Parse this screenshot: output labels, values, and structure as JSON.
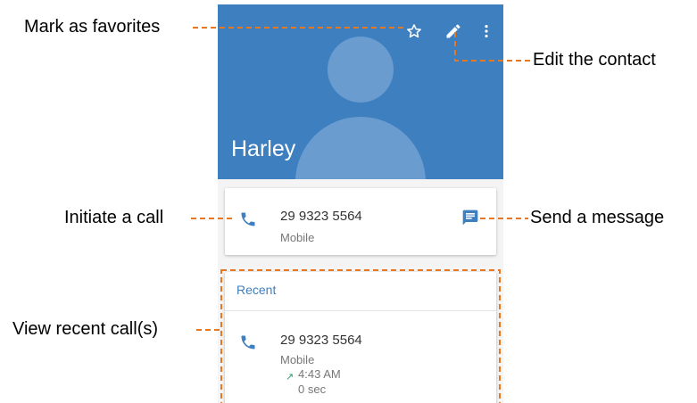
{
  "contact": {
    "name": "Harley",
    "number": "29 9323 5564",
    "type": "Mobile"
  },
  "recent": {
    "title": "Recent",
    "calls": [
      {
        "number": "29 9323 5564",
        "type": "Mobile",
        "time": "4:43 AM",
        "duration": "0 sec"
      }
    ]
  },
  "annotations": {
    "favorites": "Mark as favorites",
    "edit": "Edit the contact",
    "call": "Initiate a call",
    "message": "Send a message",
    "recent": "View recent call(s)"
  },
  "icons": {
    "favorite": "star-outline-icon",
    "edit": "pencil-icon",
    "more": "more-vert-icon",
    "call": "phone-icon",
    "message": "message-icon",
    "outgoing": "outgoing-arrow-icon"
  },
  "colors": {
    "header": "#3d7fbf",
    "avatar": "#6a9cd0",
    "accent": "#3d7fbf",
    "annotation_line": "#e87722",
    "outgoing_arrow": "#2e9e6a"
  }
}
